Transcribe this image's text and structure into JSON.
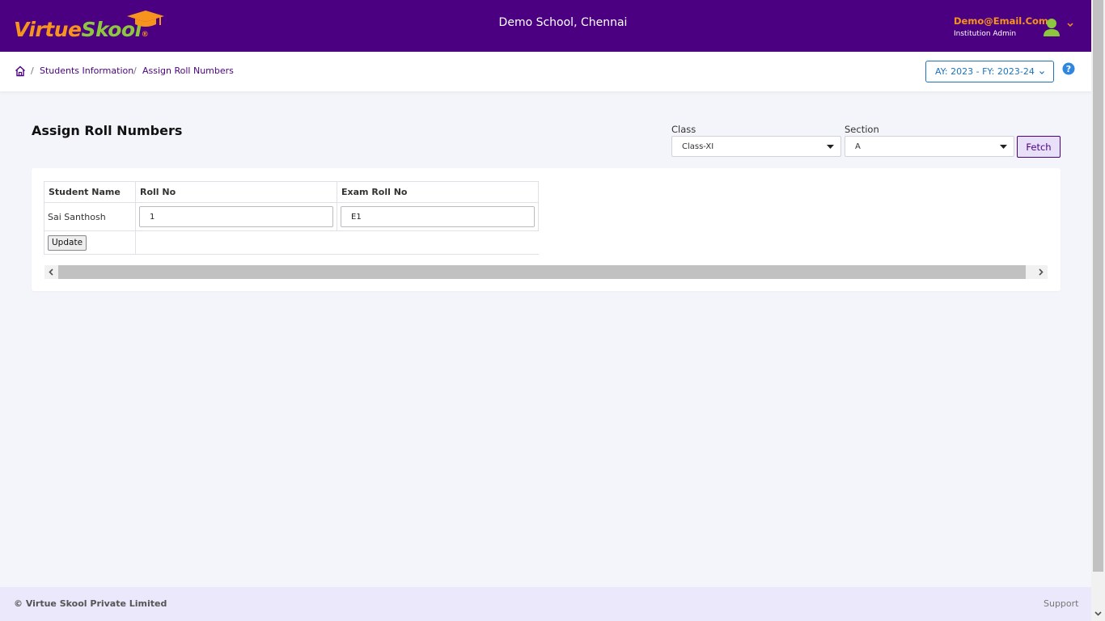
{
  "header": {
    "logo_primary": "Virtue",
    "logo_secondary": "Skool",
    "logo_reg": "®",
    "school_name": "Demo School, Chennai",
    "user_email": "Demo@Email.Com",
    "user_role": "Institution Admin"
  },
  "breadcrumb": {
    "items": [
      "Students Information",
      "Assign Roll Numbers"
    ],
    "separator": "/"
  },
  "academic_year": {
    "label": "AY: 2023 - FY: 2023-24"
  },
  "page": {
    "title": "Assign Roll Numbers",
    "class_label": "Class",
    "class_value": "Class-XI",
    "section_label": "Section",
    "section_value": "A",
    "fetch_label": "Fetch"
  },
  "table": {
    "headers": [
      "Student Name",
      "Roll No",
      "Exam Roll No"
    ],
    "rows": [
      {
        "student_name": "Sai Santhosh",
        "roll_no": "1",
        "exam_roll_no": "E1"
      }
    ],
    "update_label": "Update"
  },
  "footer": {
    "copyright": "© Virtue Skool Private Limited",
    "support": "Support"
  },
  "icons": {
    "home": "home-icon",
    "user": "user-avatar-icon",
    "help": "help-icon",
    "caret": "chevron-down-icon"
  },
  "colors": {
    "brand_purple": "#4b0082",
    "logo_orange": "#f7941d",
    "logo_green": "#8dc63f",
    "link_blue": "#1e73be"
  }
}
